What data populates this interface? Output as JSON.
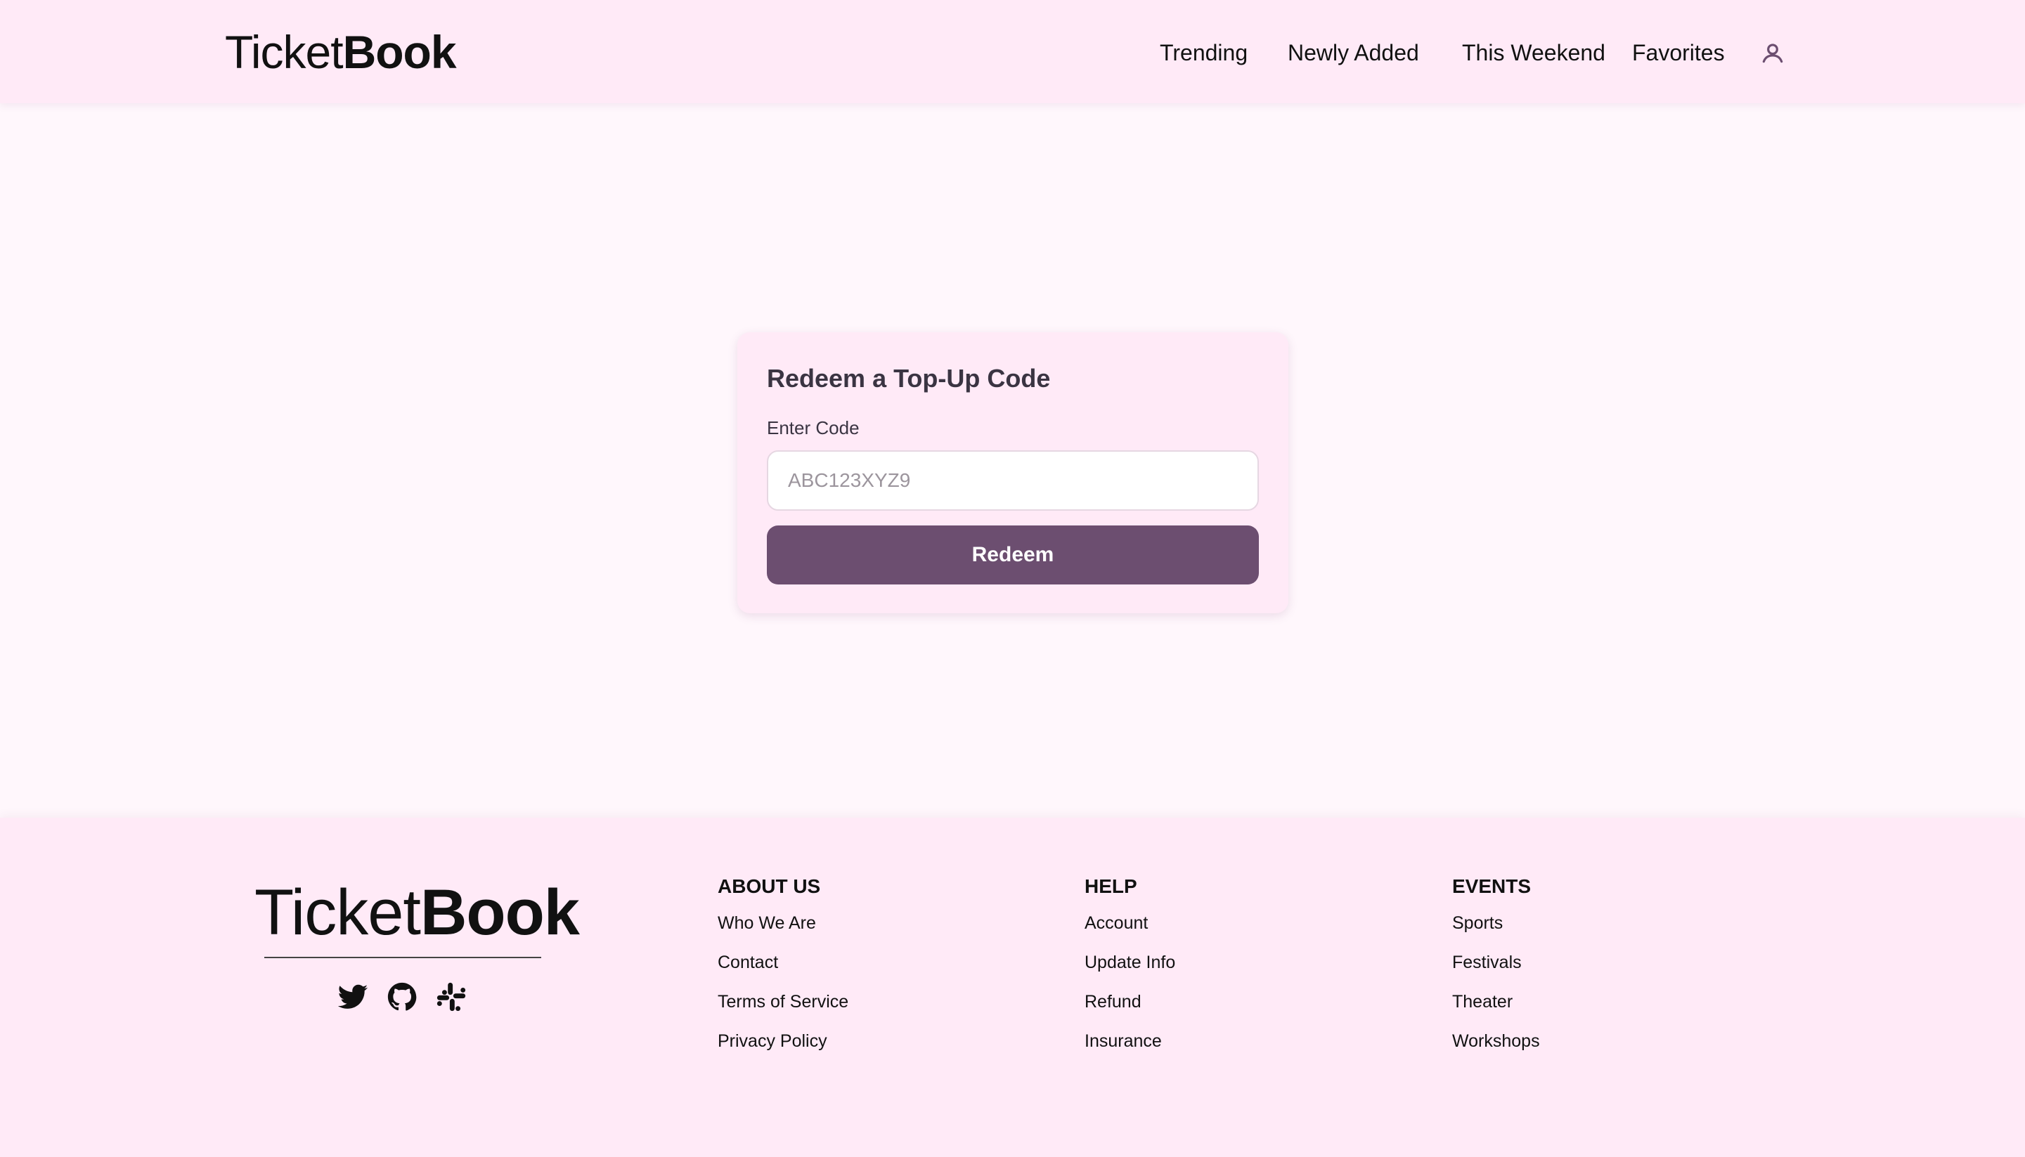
{
  "header": {
    "brand_light": "Ticket",
    "brand_bold": "Book",
    "nav": {
      "trending": "Trending",
      "newly_added": "Newly Added",
      "this_weekend": "This Weekend",
      "favorites": "Favorites"
    },
    "user_icon": "user-icon"
  },
  "redeem": {
    "title": "Redeem a Top-Up Code",
    "label": "Enter Code",
    "input_value": "",
    "placeholder": "ABC123XYZ9",
    "button_label": "Redeem"
  },
  "footer": {
    "brand_light": "Ticket",
    "brand_bold": "Book",
    "social_icons": [
      "twitter-icon",
      "github-icon",
      "slack-icon"
    ],
    "columns": [
      {
        "heading": "ABOUT US",
        "links": [
          "Who We Are",
          "Contact",
          "Terms of Service",
          "Privacy Policy"
        ]
      },
      {
        "heading": "HELP",
        "links": [
          "Account",
          "Update Info",
          "Refund",
          "Insurance"
        ]
      },
      {
        "heading": "EVENTS",
        "links": [
          "Sports",
          "Festivals",
          "Theater",
          "Workshops"
        ]
      }
    ]
  },
  "colors": {
    "page_background": "#fff7fc",
    "header_background": "#ffeaf7",
    "card_background": "#ffeaf7",
    "button_background": "#6c4e70",
    "button_text": "#ffffff",
    "text": "#111111"
  }
}
